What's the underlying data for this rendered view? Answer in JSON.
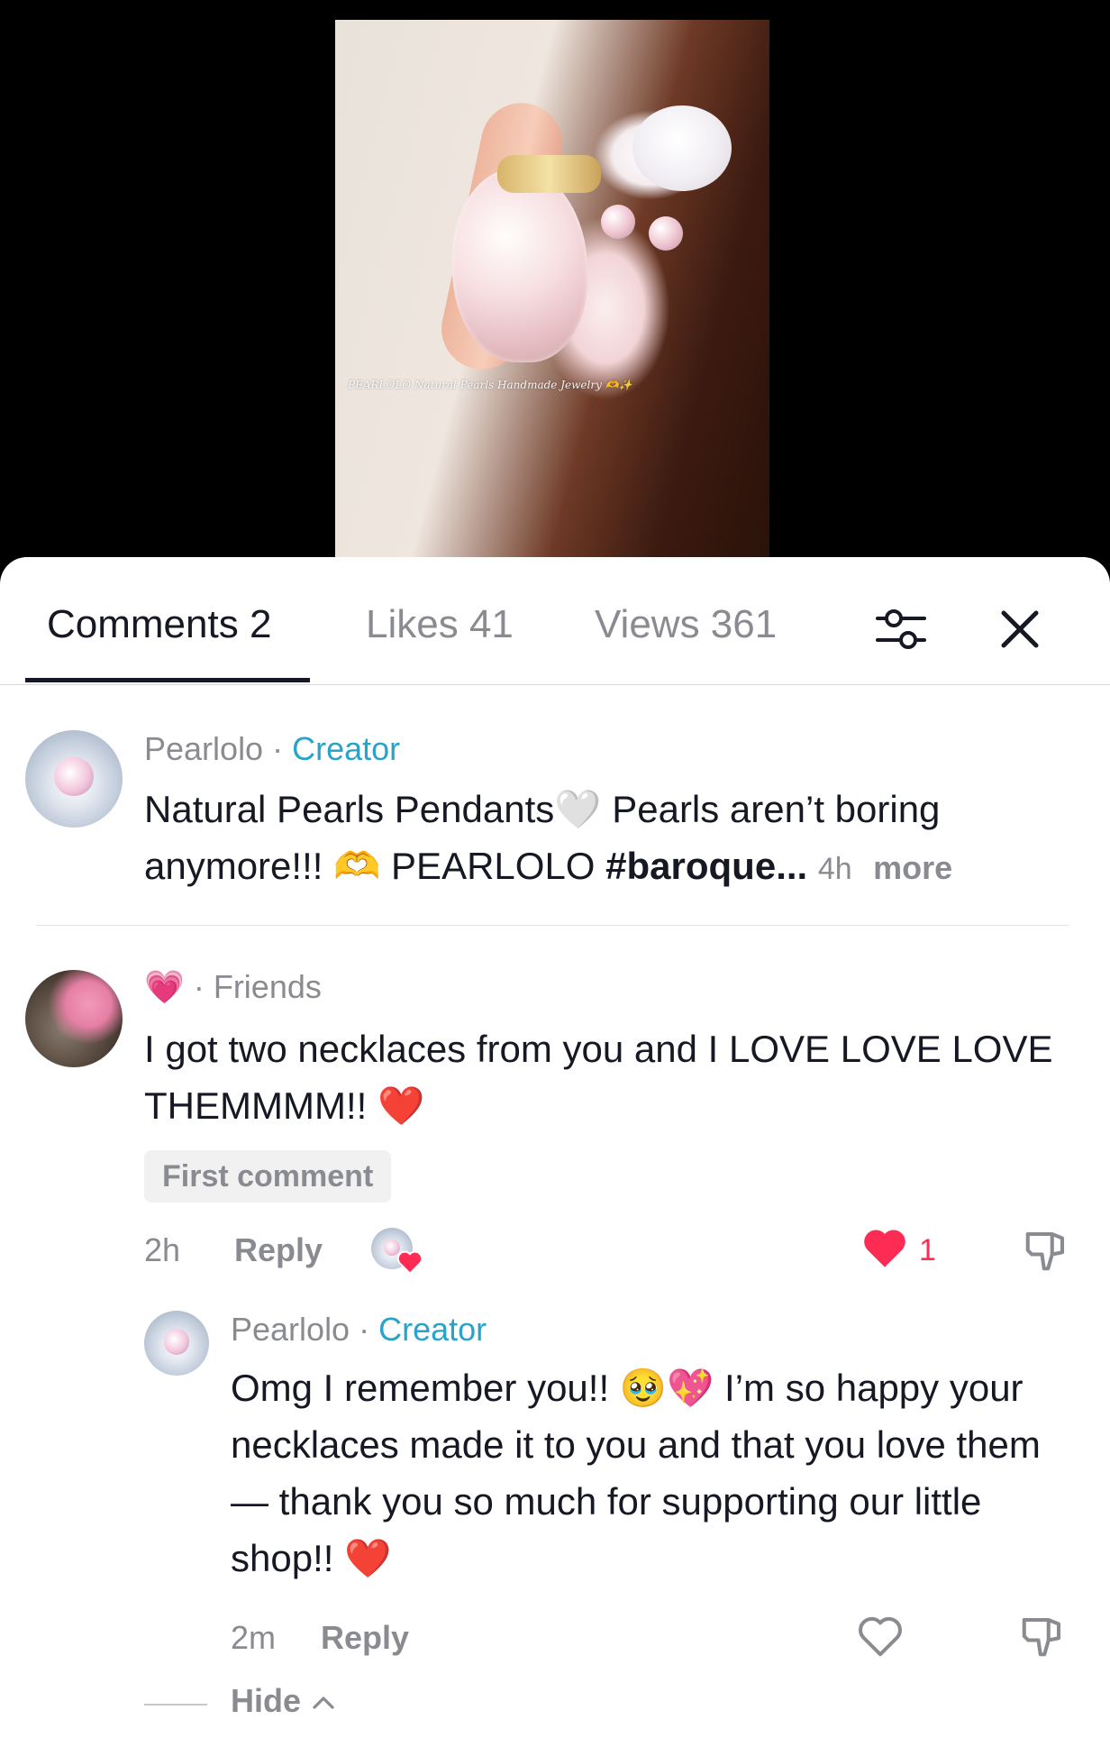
{
  "video": {
    "watermark": "PEARLOLO Natural Pearls Handmade Jewelry 🫶✨"
  },
  "tabs": [
    {
      "label": "Comments 2",
      "active": true
    },
    {
      "label": "Likes 41",
      "active": false
    },
    {
      "label": "Views 361",
      "active": false
    }
  ],
  "icons": {
    "filter": "filter-sliders-icon",
    "close": "close-icon",
    "like": "heart-icon",
    "dislike": "thumbs-down-icon"
  },
  "colors": {
    "accent_red": "#fe2c55",
    "creator_blue": "#2aa3c8"
  },
  "comments": [
    {
      "author": "Pearlolo",
      "separator": " · ",
      "role": "Creator",
      "text_a": "Natural Pearls Pendants🤍 Pearls aren’t boring anymore!!! 🫶  PEARLOLO ",
      "hashtag": "#baroque",
      "ellipsis": "...",
      "time": "4h",
      "more": "more"
    },
    {
      "author_emoji": "💗",
      "separator": " · ",
      "role": "Friends",
      "text": "I got two necklaces from you and I LOVE LOVE LOVE THEMMMM!! ❤️",
      "badge": "First comment",
      "time": "2h",
      "reply_label": "Reply",
      "like_count": "1",
      "replies": [
        {
          "author": "Pearlolo",
          "separator": " · ",
          "role": "Creator",
          "text": "Omg I remember you!! 🥹💖 I’m so happy your necklaces made it to you and that you love them — thank you so much for supporting our little shop!! ❤️",
          "time": "2m",
          "reply_label": "Reply"
        }
      ],
      "hide_label": "Hide",
      "hide_icon": "chevron-up-icon"
    }
  ]
}
